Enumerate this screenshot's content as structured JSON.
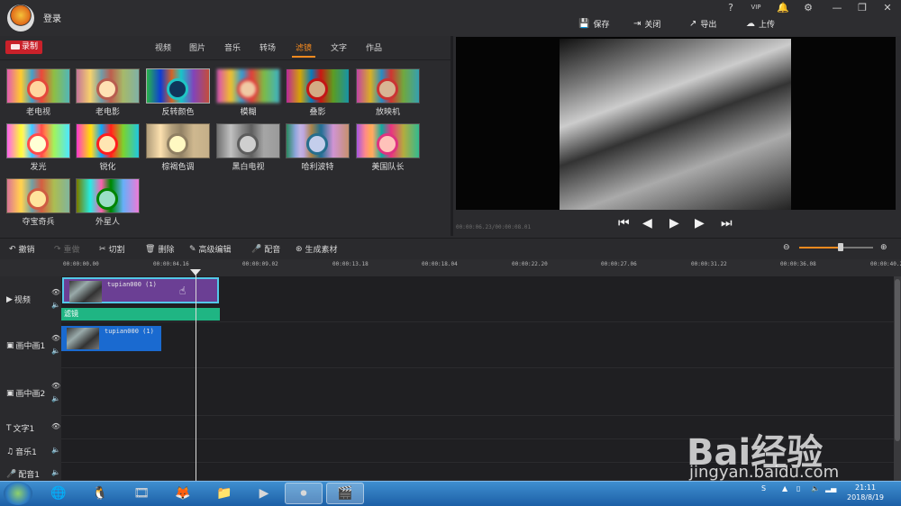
{
  "header": {
    "login_label": "登录",
    "actions": [
      {
        "label": "保存",
        "icon": "save-icon"
      },
      {
        "label": "关闭",
        "icon": "exit-icon"
      },
      {
        "label": "导出",
        "icon": "export-icon"
      },
      {
        "label": "上传",
        "icon": "upload-icon"
      }
    ],
    "vip_label": "VIP"
  },
  "media": {
    "record_label": "录制",
    "tabs": [
      "视频",
      "图片",
      "音乐",
      "转场",
      "滤镜",
      "文字",
      "作品"
    ],
    "active_tab": "滤镜",
    "filters": [
      "老电视",
      "老电影",
      "反转颜色",
      "模糊",
      "叠影",
      "放映机",
      "发光",
      "锐化",
      "棕褐色调",
      "黑白电视",
      "哈利波特",
      "美国队长",
      "夺宝奇兵",
      "外星人"
    ]
  },
  "preview": {
    "timecode": "00:00:06.23/00:00:08.01"
  },
  "toolbar": {
    "undo": "撤销",
    "redo": "重做",
    "cut": "切割",
    "delete": "删除",
    "advanced_edit": "高级编辑",
    "dub": "配音",
    "generate": "生成素材",
    "zoom_level": 0.56
  },
  "timeline": {
    "ticks": [
      "00:00:00.00",
      "00:00:04.16",
      "00:00:09.02",
      "00:00:13.18",
      "00:00:18.04",
      "00:00:22.20",
      "00:00:27.06",
      "00:00:31.22",
      "00:00:36.08",
      "00:00:40.24"
    ],
    "tracks": [
      "视频",
      "画中画1",
      "画中画2",
      "文字1",
      "音乐1",
      "配音1"
    ],
    "clip_video": "tupian000 (1)",
    "clip_filter": "滤镜",
    "clip_pip": "tupian000 (1)"
  },
  "taskbar": {
    "time": "21:11",
    "date": "2018/8/19"
  },
  "watermark": {
    "brand": "Bai经验",
    "url": "jingyan.baidu.com"
  }
}
